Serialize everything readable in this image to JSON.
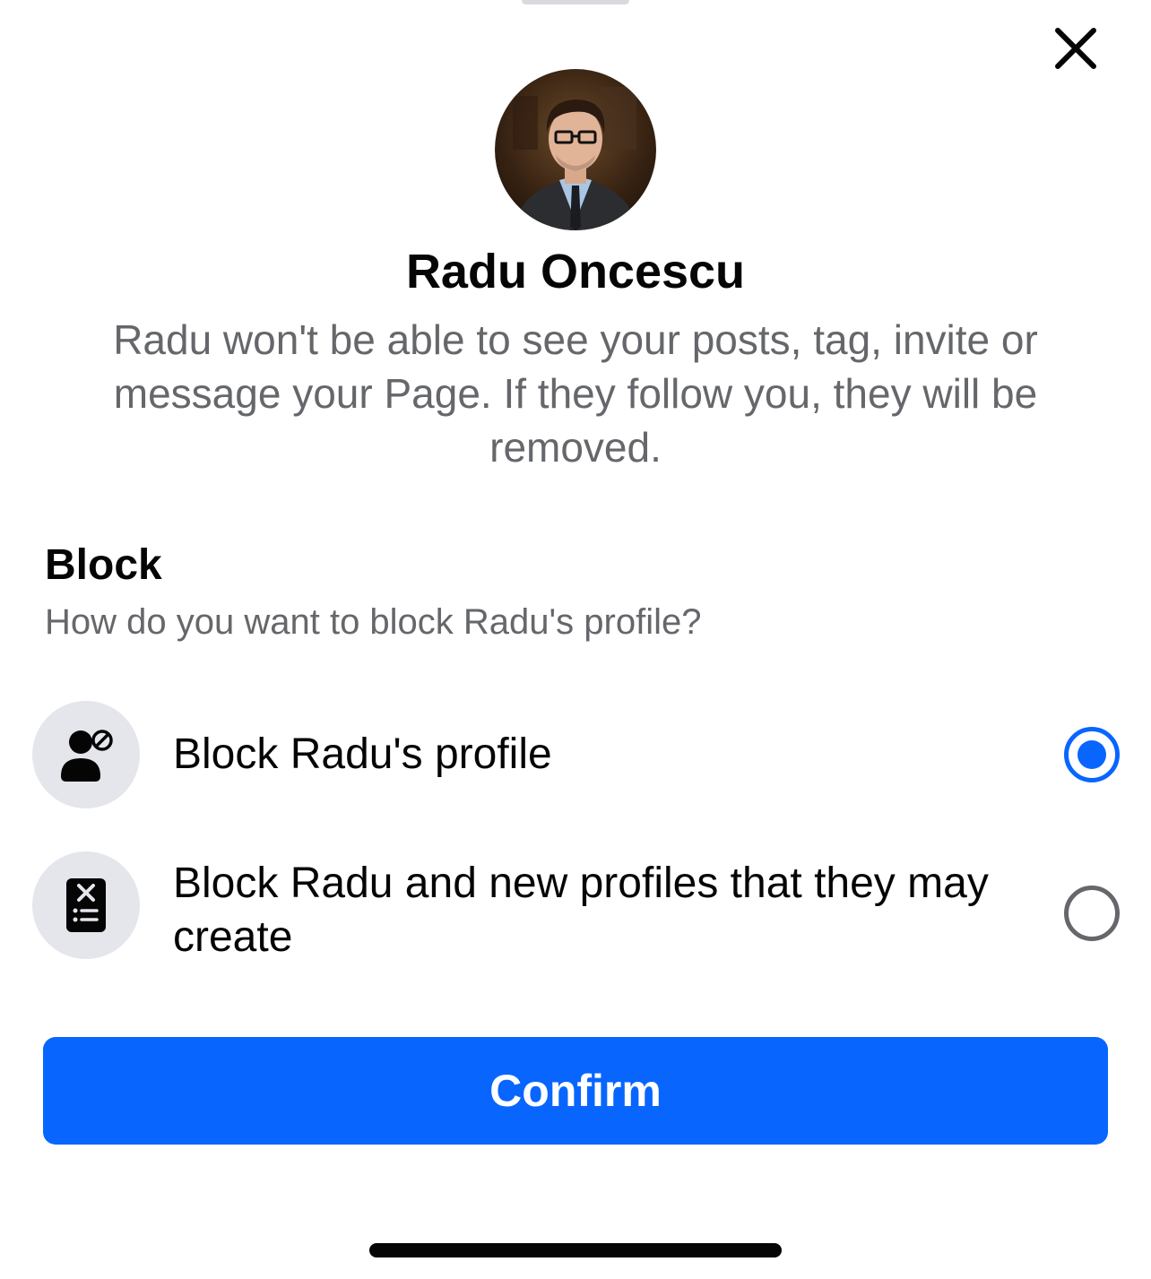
{
  "sheet": {
    "close_icon": "close-icon"
  },
  "profile": {
    "name": "Radu Oncescu",
    "description": "Radu won't be able to see your posts, tag, invite or message your Page. If they follow you, they will be removed."
  },
  "block_section": {
    "title": "Block",
    "subtitle": "How do you want to block Radu's profile?",
    "options": [
      {
        "label": "Block Radu's profile",
        "icon": "person-block-icon",
        "selected": true
      },
      {
        "label": "Block Radu and new profiles that they may create",
        "icon": "blocklist-icon",
        "selected": false
      }
    ]
  },
  "actions": {
    "confirm_label": "Confirm"
  },
  "colors": {
    "accent": "#0866ff",
    "secondary_text": "#65676b",
    "icon_bg": "#e4e6eb"
  }
}
